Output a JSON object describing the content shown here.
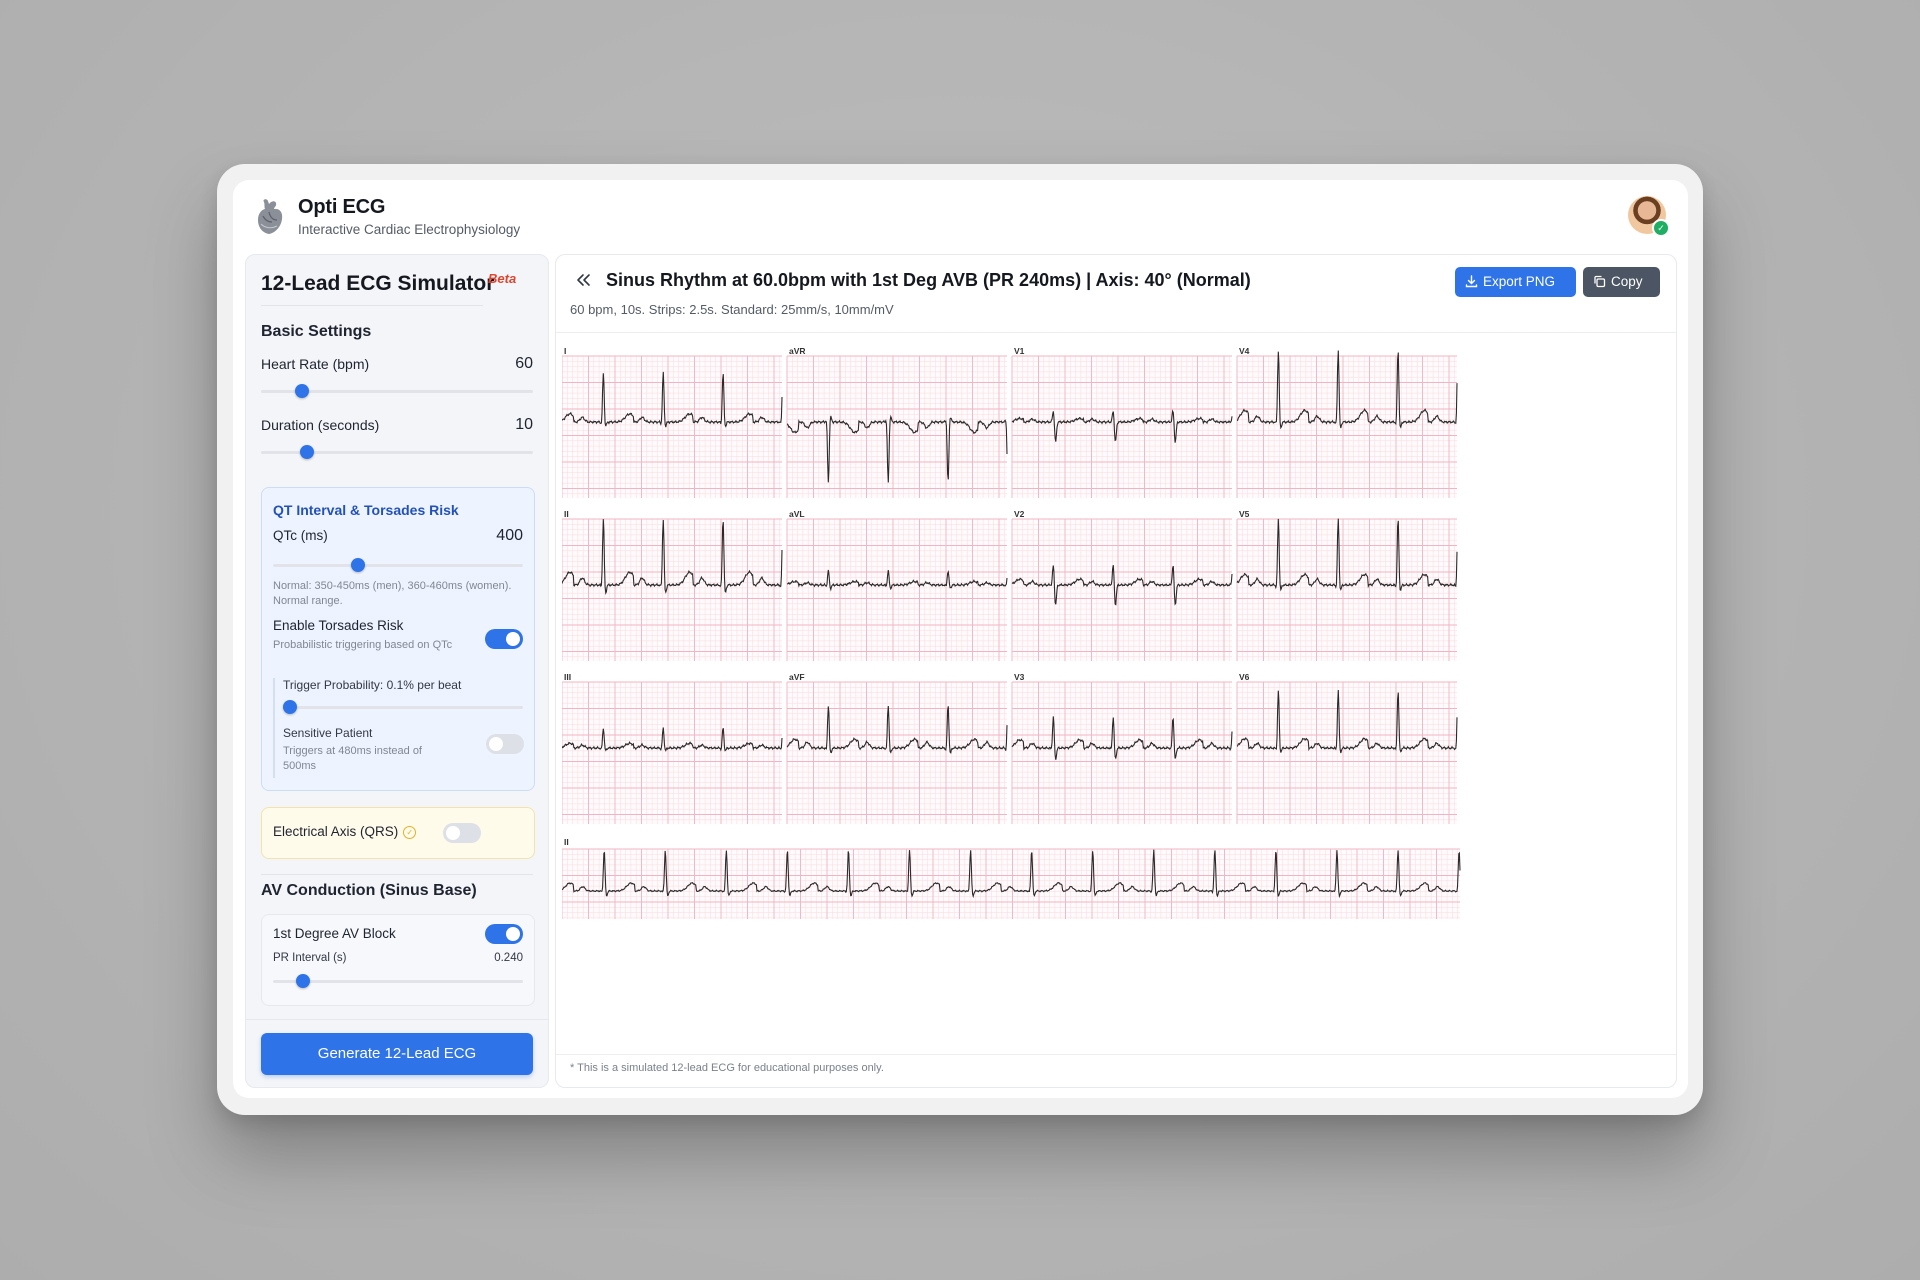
{
  "app": {
    "title": "Opti ECG",
    "subtitle": "Interactive Cardiac Electrophysiology"
  },
  "sidebar": {
    "title": "12-Lead ECG Simulator",
    "badge": "Beta",
    "basic": {
      "heading": "Basic Settings",
      "heart_rate": {
        "label": "Heart Rate (bpm)",
        "value": "60",
        "fraction": 0.15
      },
      "duration": {
        "label": "Duration (seconds)",
        "value": "10",
        "fraction": 0.17
      }
    },
    "qt": {
      "heading": "QT Interval & Torsades Risk",
      "qtc": {
        "label": "QTc (ms)",
        "value": "400",
        "fraction": 0.34
      },
      "help": "Normal: 350-450ms (men), 360-460ms (women). Normal range.",
      "torsades": {
        "label": "Enable Torsades Risk",
        "help": "Probabilistic triggering based on QTc",
        "on": true
      },
      "trigger": {
        "label": "Trigger Probability: 0.1% per beat",
        "fraction": 0.03
      },
      "sensitive": {
        "label": "Sensitive Patient",
        "help": "Triggers at 480ms instead of 500ms",
        "on": false
      }
    },
    "axis": {
      "label": "Electrical Axis (QRS)",
      "on": false
    },
    "av": {
      "heading": "AV Conduction (Sinus Base)",
      "first_degree": {
        "label": "1st Degree AV Block",
        "on": true
      },
      "pr": {
        "label": "PR Interval (s)",
        "value": "0.240",
        "fraction": 0.12
      }
    },
    "generate_label": "Generate 12-Lead ECG"
  },
  "main": {
    "title": "Sinus Rhythm at 60.0bpm with 1st Deg AVB (PR 240ms) | Axis: 40° (Normal)",
    "subtitle": "60 bpm, 10s. Strips: 2.5s. Standard: 25mm/s, 10mm/mV",
    "export_label": "Export PNG",
    "copy_label": "Copy",
    "footnote": "* This is a simulated 12-lead ECG for educational purposes only."
  },
  "ecg": {
    "leads": [
      [
        "I",
        "aVR",
        "V1",
        "V4"
      ],
      [
        "II",
        "aVL",
        "V2",
        "V5"
      ],
      [
        "III",
        "aVF",
        "V3",
        "V6"
      ]
    ],
    "rhythm_lead": "II",
    "heart_rate_bpm": 60,
    "pr_interval_s": 0.24,
    "strip_seconds": 2.5,
    "rhythm_seconds": 10,
    "grid_minor_color": "#f8dbe3",
    "grid_major_color": "#f0b4c3",
    "trace_color": "#2a2a2a"
  }
}
